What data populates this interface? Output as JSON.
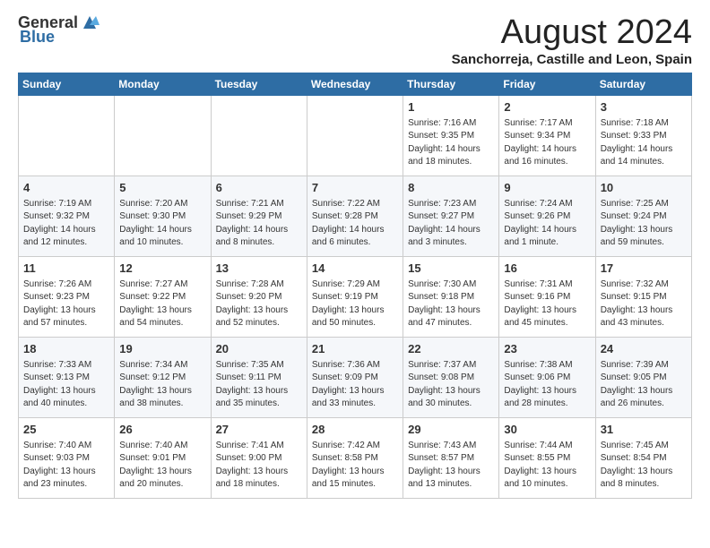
{
  "logo": {
    "general": "General",
    "blue": "Blue"
  },
  "title": "August 2024",
  "location": "Sanchorreja, Castille and Leon, Spain",
  "headers": [
    "Sunday",
    "Monday",
    "Tuesday",
    "Wednesday",
    "Thursday",
    "Friday",
    "Saturday"
  ],
  "weeks": [
    [
      {
        "day": "",
        "info": ""
      },
      {
        "day": "",
        "info": ""
      },
      {
        "day": "",
        "info": ""
      },
      {
        "day": "",
        "info": ""
      },
      {
        "day": "1",
        "info": "Sunrise: 7:16 AM\nSunset: 9:35 PM\nDaylight: 14 hours\nand 18 minutes."
      },
      {
        "day": "2",
        "info": "Sunrise: 7:17 AM\nSunset: 9:34 PM\nDaylight: 14 hours\nand 16 minutes."
      },
      {
        "day": "3",
        "info": "Sunrise: 7:18 AM\nSunset: 9:33 PM\nDaylight: 14 hours\nand 14 minutes."
      }
    ],
    [
      {
        "day": "4",
        "info": "Sunrise: 7:19 AM\nSunset: 9:32 PM\nDaylight: 14 hours\nand 12 minutes."
      },
      {
        "day": "5",
        "info": "Sunrise: 7:20 AM\nSunset: 9:30 PM\nDaylight: 14 hours\nand 10 minutes."
      },
      {
        "day": "6",
        "info": "Sunrise: 7:21 AM\nSunset: 9:29 PM\nDaylight: 14 hours\nand 8 minutes."
      },
      {
        "day": "7",
        "info": "Sunrise: 7:22 AM\nSunset: 9:28 PM\nDaylight: 14 hours\nand 6 minutes."
      },
      {
        "day": "8",
        "info": "Sunrise: 7:23 AM\nSunset: 9:27 PM\nDaylight: 14 hours\nand 3 minutes."
      },
      {
        "day": "9",
        "info": "Sunrise: 7:24 AM\nSunset: 9:26 PM\nDaylight: 14 hours\nand 1 minute."
      },
      {
        "day": "10",
        "info": "Sunrise: 7:25 AM\nSunset: 9:24 PM\nDaylight: 13 hours\nand 59 minutes."
      }
    ],
    [
      {
        "day": "11",
        "info": "Sunrise: 7:26 AM\nSunset: 9:23 PM\nDaylight: 13 hours\nand 57 minutes."
      },
      {
        "day": "12",
        "info": "Sunrise: 7:27 AM\nSunset: 9:22 PM\nDaylight: 13 hours\nand 54 minutes."
      },
      {
        "day": "13",
        "info": "Sunrise: 7:28 AM\nSunset: 9:20 PM\nDaylight: 13 hours\nand 52 minutes."
      },
      {
        "day": "14",
        "info": "Sunrise: 7:29 AM\nSunset: 9:19 PM\nDaylight: 13 hours\nand 50 minutes."
      },
      {
        "day": "15",
        "info": "Sunrise: 7:30 AM\nSunset: 9:18 PM\nDaylight: 13 hours\nand 47 minutes."
      },
      {
        "day": "16",
        "info": "Sunrise: 7:31 AM\nSunset: 9:16 PM\nDaylight: 13 hours\nand 45 minutes."
      },
      {
        "day": "17",
        "info": "Sunrise: 7:32 AM\nSunset: 9:15 PM\nDaylight: 13 hours\nand 43 minutes."
      }
    ],
    [
      {
        "day": "18",
        "info": "Sunrise: 7:33 AM\nSunset: 9:13 PM\nDaylight: 13 hours\nand 40 minutes."
      },
      {
        "day": "19",
        "info": "Sunrise: 7:34 AM\nSunset: 9:12 PM\nDaylight: 13 hours\nand 38 minutes."
      },
      {
        "day": "20",
        "info": "Sunrise: 7:35 AM\nSunset: 9:11 PM\nDaylight: 13 hours\nand 35 minutes."
      },
      {
        "day": "21",
        "info": "Sunrise: 7:36 AM\nSunset: 9:09 PM\nDaylight: 13 hours\nand 33 minutes."
      },
      {
        "day": "22",
        "info": "Sunrise: 7:37 AM\nSunset: 9:08 PM\nDaylight: 13 hours\nand 30 minutes."
      },
      {
        "day": "23",
        "info": "Sunrise: 7:38 AM\nSunset: 9:06 PM\nDaylight: 13 hours\nand 28 minutes."
      },
      {
        "day": "24",
        "info": "Sunrise: 7:39 AM\nSunset: 9:05 PM\nDaylight: 13 hours\nand 26 minutes."
      }
    ],
    [
      {
        "day": "25",
        "info": "Sunrise: 7:40 AM\nSunset: 9:03 PM\nDaylight: 13 hours\nand 23 minutes."
      },
      {
        "day": "26",
        "info": "Sunrise: 7:40 AM\nSunset: 9:01 PM\nDaylight: 13 hours\nand 20 minutes."
      },
      {
        "day": "27",
        "info": "Sunrise: 7:41 AM\nSunset: 9:00 PM\nDaylight: 13 hours\nand 18 minutes."
      },
      {
        "day": "28",
        "info": "Sunrise: 7:42 AM\nSunset: 8:58 PM\nDaylight: 13 hours\nand 15 minutes."
      },
      {
        "day": "29",
        "info": "Sunrise: 7:43 AM\nSunset: 8:57 PM\nDaylight: 13 hours\nand 13 minutes."
      },
      {
        "day": "30",
        "info": "Sunrise: 7:44 AM\nSunset: 8:55 PM\nDaylight: 13 hours\nand 10 minutes."
      },
      {
        "day": "31",
        "info": "Sunrise: 7:45 AM\nSunset: 8:54 PM\nDaylight: 13 hours\nand 8 minutes."
      }
    ]
  ]
}
